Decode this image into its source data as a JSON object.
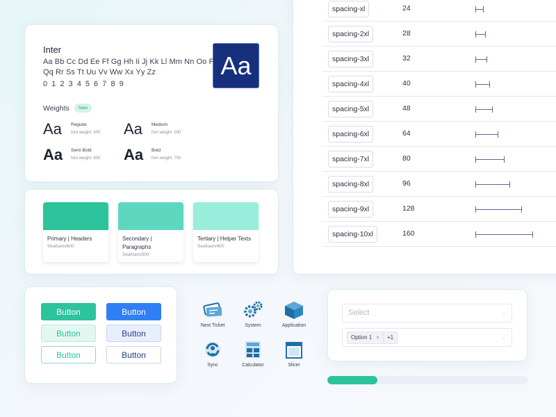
{
  "colors": {
    "seafoam600": "#2cc39d",
    "seafoam500": "#5dd8bf",
    "seafoam400": "#98eddb",
    "blue": "#2f7ff5",
    "navy": "#16307e"
  },
  "typography": {
    "font_name": "Inter",
    "alphabet_line1": "Aa Bb Cc Dd Ee Ff Gg Hh Ii Jj Kk Ll Mm Nn Oo Pp",
    "alphabet_line2": "Qq Rr Ss Tt Uu Vv Ww Xx Yy Zz",
    "digits": "0 1 2 3 4 5 6 7 8 9",
    "sample": "Aa",
    "weights_title": "Weights",
    "new_badge": "New",
    "weights": [
      {
        "sample": "Aa",
        "name": "Regular",
        "value": "font weight: 400"
      },
      {
        "sample": "Aa",
        "name": "Medium",
        "value": "font weight: 500"
      },
      {
        "sample": "Aa",
        "name": "Semi Bold",
        "value": "font weight: 600"
      },
      {
        "sample": "Aa",
        "name": "Bold",
        "value": "font weight: 700"
      }
    ]
  },
  "swatches": [
    {
      "label": "Primary | Headers",
      "sub": "Seafoam/600",
      "color": "#2cc39d"
    },
    {
      "label": "Secondary | Paragraphs",
      "sub": "Seafoam/500",
      "color": "#5dd8bf"
    },
    {
      "label": "Tertiary | Helper Texts",
      "sub": "Seafoam/400",
      "color": "#98eddb"
    }
  ],
  "spacing": [
    {
      "token": "spacing-xl",
      "value": 24
    },
    {
      "token": "spacing-2xl",
      "value": 28
    },
    {
      "token": "spacing-3xl",
      "value": 32
    },
    {
      "token": "spacing-4xl",
      "value": 40
    },
    {
      "token": "spacing-5xl",
      "value": 48
    },
    {
      "token": "spacing-6xl",
      "value": 64
    },
    {
      "token": "spacing-7xl",
      "value": 80
    },
    {
      "token": "spacing-8xl",
      "value": 96
    },
    {
      "token": "spacing-9xl",
      "value": 128
    },
    {
      "token": "spacing-10xl",
      "value": 160
    }
  ],
  "buttons": {
    "label": "Button"
  },
  "icons": [
    {
      "name": "next-ticket-icon",
      "label": "Next Ticket"
    },
    {
      "name": "system-icon",
      "label": "System"
    },
    {
      "name": "application-icon",
      "label": "Application"
    },
    {
      "name": "sync-icon",
      "label": "Sync"
    },
    {
      "name": "calculator-icon",
      "label": "Calculator"
    },
    {
      "name": "slicer-icon",
      "label": "Slicer"
    }
  ],
  "selects": {
    "placeholder": "Select",
    "chip_option": "Option 1",
    "chip_remove": "×",
    "chip_more": "+1",
    "chevron": "⌄"
  },
  "progress": {
    "percent": 25
  }
}
